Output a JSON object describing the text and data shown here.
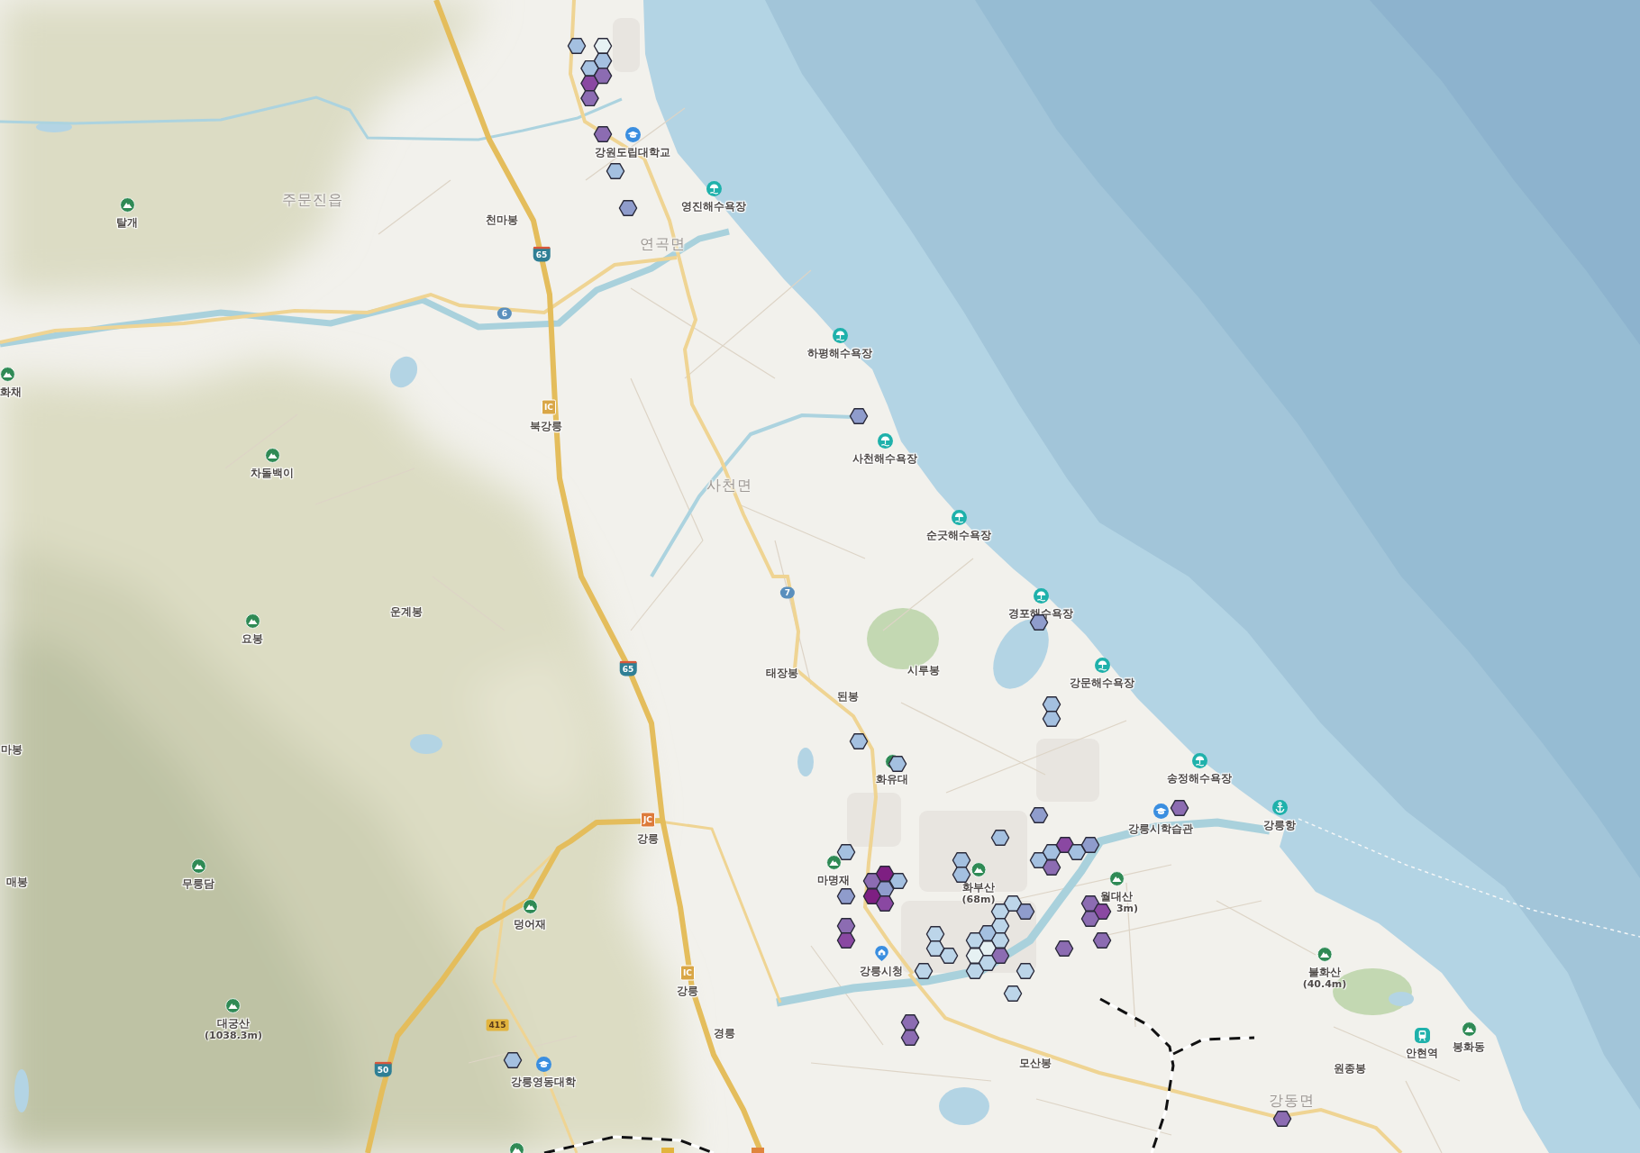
{
  "map": {
    "place_labels": [
      {
        "kind": "school",
        "name": "강원도립대학교"
      },
      {
        "kind": "district",
        "name": "주문진읍"
      },
      {
        "kind": "beach",
        "name": "영진해수욕장"
      },
      {
        "kind": "peak",
        "name": "탈개"
      },
      {
        "kind": "plain",
        "name": "천마봉"
      },
      {
        "kind": "district",
        "name": "연곡면"
      },
      {
        "kind": "beach",
        "name": "하평해수욕장"
      },
      {
        "kind": "peak",
        "name": "화채"
      },
      {
        "kind": "plain",
        "name": "북강릉"
      },
      {
        "kind": "beach",
        "name": "사천해수욕장"
      },
      {
        "kind": "peak",
        "name": "차돌백이"
      },
      {
        "kind": "district",
        "name": "사천면"
      },
      {
        "kind": "beach",
        "name": "순긋해수욕장"
      },
      {
        "kind": "plain",
        "name": "운계봉"
      },
      {
        "kind": "beach",
        "name": "경포해수욕장"
      },
      {
        "kind": "peak",
        "name": "요봉"
      },
      {
        "kind": "plain",
        "name": "태장봉"
      },
      {
        "kind": "plain",
        "name": "시루봉"
      },
      {
        "kind": "beach",
        "name": "강문해수욕장"
      },
      {
        "kind": "plain",
        "name": "된봉"
      },
      {
        "kind": "plain",
        "name": "마봉"
      },
      {
        "kind": "peak",
        "name": "화유대"
      },
      {
        "kind": "beach",
        "name": "송정해수욕장"
      },
      {
        "kind": "plain",
        "name": "강릉"
      },
      {
        "kind": "school",
        "name": "강릉시학습관"
      },
      {
        "kind": "port",
        "name": "강릉항"
      },
      {
        "kind": "plain",
        "name": "매봉"
      },
      {
        "kind": "peak",
        "name": "무릉담"
      },
      {
        "kind": "peak",
        "name": "마명재"
      },
      {
        "kind": "peak",
        "name": "화부산",
        "elevation": "(68m)"
      },
      {
        "kind": "peak",
        "name": "월대산",
        "elevation": "3m)"
      },
      {
        "kind": "peak",
        "name": "덩어재"
      },
      {
        "kind": "cityhall",
        "name": "강릉시청"
      },
      {
        "kind": "peak",
        "name": "불화산",
        "elevation": "(40.4m)"
      },
      {
        "kind": "plain",
        "name": "강릉"
      },
      {
        "kind": "peak",
        "name": "대궁산",
        "elevation": "(1038.3m)"
      },
      {
        "kind": "plain",
        "name": "경릉"
      },
      {
        "kind": "plain",
        "name": "모산봉"
      },
      {
        "kind": "plain",
        "name": "원종봉"
      },
      {
        "kind": "station",
        "name": "안현역"
      },
      {
        "kind": "peak",
        "name": "봉화동"
      },
      {
        "kind": "school",
        "name": "강릉영동대학"
      },
      {
        "kind": "district",
        "name": "강동면"
      }
    ],
    "road_signs": [
      {
        "kind": "expressway",
        "text": "65"
      },
      {
        "kind": "national",
        "text": "6"
      },
      {
        "kind": "interchange",
        "text": "IC"
      },
      {
        "kind": "national",
        "text": "7"
      },
      {
        "kind": "expressway",
        "text": "65"
      },
      {
        "kind": "junction",
        "text": "JC"
      },
      {
        "kind": "interchange",
        "text": "IC"
      },
      {
        "kind": "local",
        "text": "415"
      },
      {
        "kind": "expressway",
        "text": "50"
      }
    ],
    "hexbins": [
      {
        "color": "#a4c0e0"
      },
      {
        "color": "#e6f1f3"
      },
      {
        "color": "#a4c0e0"
      },
      {
        "color": "#a6c2e1"
      },
      {
        "color": "#8c6cb2"
      },
      {
        "color": "#8a48a2"
      },
      {
        "color": "#8c6cb2"
      },
      {
        "color": "#8c6cb2"
      },
      {
        "color": "#a4c0e0"
      },
      {
        "color": "#8f9ccc"
      },
      {
        "color": "#8f9ccc"
      },
      {
        "color": "#8f9ccc"
      },
      {
        "color": "#a4c0e0"
      },
      {
        "color": "#a4c0e0"
      },
      {
        "color": "#a4c0e0"
      },
      {
        "color": "#a4c0e0"
      },
      {
        "color": "#8f9ccc"
      },
      {
        "color": "#a4c0e0"
      },
      {
        "color": "#a4c0e0"
      },
      {
        "color": "#a4c0e0"
      },
      {
        "color": "#a4c0e0"
      },
      {
        "color": "#a4c0e0"
      },
      {
        "color": "#a4c0e0"
      },
      {
        "color": "#8a48a2"
      },
      {
        "color": "#a4c0e0"
      },
      {
        "color": "#8f9ccc"
      },
      {
        "color": "#8c6cb2"
      },
      {
        "color": "#8c6cb2"
      },
      {
        "color": "#7e1f82"
      },
      {
        "color": "#a4c0e0"
      },
      {
        "color": "#8f9ccc"
      },
      {
        "color": "#7e1f82"
      },
      {
        "color": "#8a48a2"
      },
      {
        "color": "#8f9ccc"
      },
      {
        "color": "#8c6cb2"
      },
      {
        "color": "#8a48a2"
      },
      {
        "color": "#bcd5e9"
      },
      {
        "color": "#8f9ccc"
      },
      {
        "color": "#bcd5e9"
      },
      {
        "color": "#bcd5e9"
      },
      {
        "color": "#a4c0e0"
      },
      {
        "color": "#bcd5e9"
      },
      {
        "color": "#bcd5e9"
      },
      {
        "color": "#e6f1f3"
      },
      {
        "color": "#e6f1f3"
      },
      {
        "color": "#8c6cb2"
      },
      {
        "color": "#bcd5e9"
      },
      {
        "color": "#bcd5e9"
      },
      {
        "color": "#bcd5e9"
      },
      {
        "color": "#bcd5e9"
      },
      {
        "color": "#bcd5e9"
      },
      {
        "color": "#bcd5e9"
      },
      {
        "color": "#bcd5e9"
      },
      {
        "color": "#bcd5e9"
      },
      {
        "color": "#8c6cb2"
      },
      {
        "color": "#8c6cb2"
      },
      {
        "color": "#8c6cb2"
      },
      {
        "color": "#8a48a2"
      },
      {
        "color": "#8c6cb2"
      },
      {
        "color": "#8c6cb2"
      },
      {
        "color": "#8c6cb2"
      },
      {
        "color": "#a4c0e0"
      },
      {
        "color": "#8c6cb2"
      },
      {
        "color": "#8c6cb2"
      }
    ]
  }
}
